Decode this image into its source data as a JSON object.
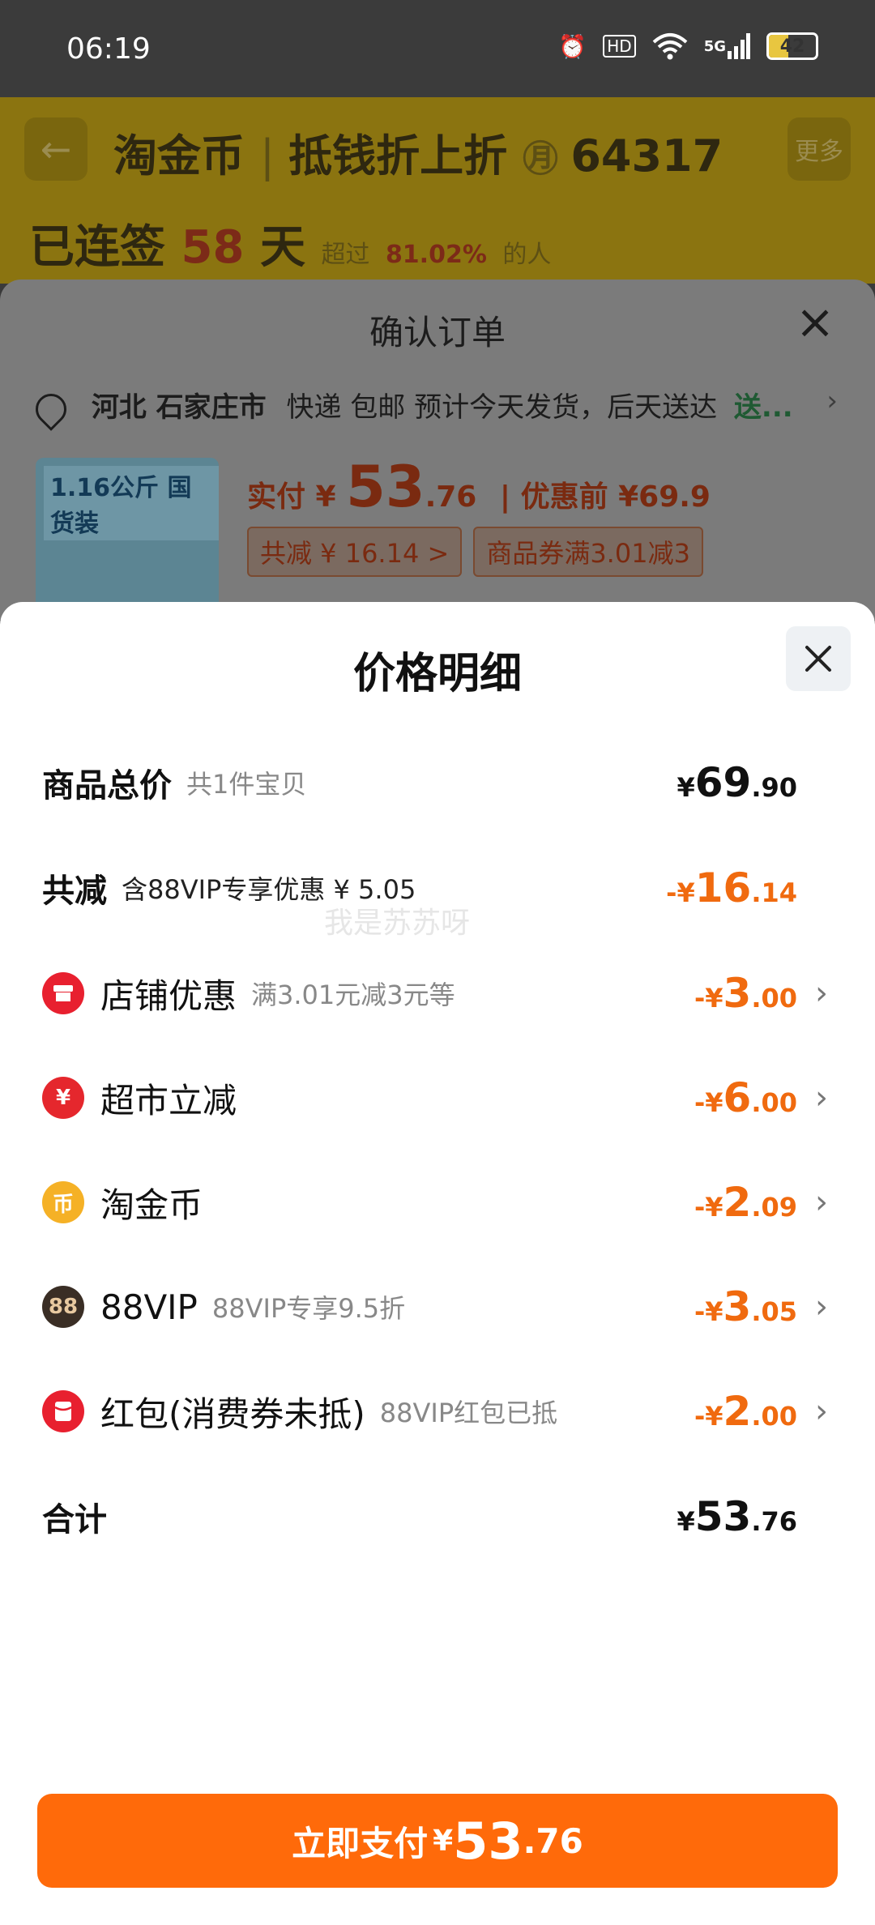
{
  "status_bar": {
    "time": "06:19",
    "hd": "HD",
    "net": "5G",
    "battery": "42",
    "battery_level": 0.42
  },
  "background_app": {
    "title": "淘金币",
    "subtitle": "抵钱折上折",
    "coins": "64317",
    "more_label": "更多",
    "sign_prefix": "已连签",
    "sign_days": "58",
    "sign_unit": "天",
    "sign_desc_prefix": "超过",
    "sign_percent": "81.02%",
    "sign_desc_suffix": "的人"
  },
  "order_sheet": {
    "title": "确认订单",
    "address_city": "河北 石家庄市",
    "address_delivery": "快递 包邮 预计今天发货，后天送达",
    "address_green": "送...",
    "product_badge": "1.16公斤 国货装",
    "pay_label": "实付 ¥",
    "pay_int": "53",
    "pay_dec": ".76",
    "before_label": "| 优惠前 ¥69.9",
    "tag_saving": "共减 ¥ 16.14 >",
    "tag_coupon": "商品券满3.01减3"
  },
  "detail": {
    "title": "价格明细",
    "watermark": "我是苏苏呀",
    "total_goods": {
      "label": "商品总价",
      "sub": "共1件宝贝",
      "y": "¥",
      "i": "69",
      "d": ".90"
    },
    "total_reduce": {
      "label": "共减",
      "sub": "含88VIP专享优惠 ¥ 5.05",
      "y": "-¥",
      "i": "16",
      "d": ".14"
    },
    "items": [
      {
        "label": "店铺优惠",
        "sub": "满3.01元减3元等",
        "y": "-¥",
        "i": "3",
        "d": ".00",
        "icon": "store-icon"
      },
      {
        "label": "超市立减",
        "sub": "",
        "y": "-¥",
        "i": "6",
        "d": ".00",
        "icon": "yuan-refresh-icon"
      },
      {
        "label": "淘金币",
        "sub": "",
        "y": "-¥",
        "i": "2",
        "d": ".09",
        "icon": "coin-icon"
      },
      {
        "label": "88VIP",
        "sub": "88VIP专享9.5折",
        "y": "-¥",
        "i": "3",
        "d": ".05",
        "icon": "vip-88-icon"
      },
      {
        "label": "红包(消费券未抵)",
        "sub": "88VIP红包已抵",
        "y": "-¥",
        "i": "2",
        "d": ".00",
        "icon": "red-packet-icon"
      }
    ],
    "sum": {
      "label": "合计",
      "y": "¥",
      "i": "53",
      "d": ".76"
    },
    "pay_button": {
      "text": "立即支付",
      "y": "¥",
      "i": "53",
      "d": ".76"
    }
  }
}
